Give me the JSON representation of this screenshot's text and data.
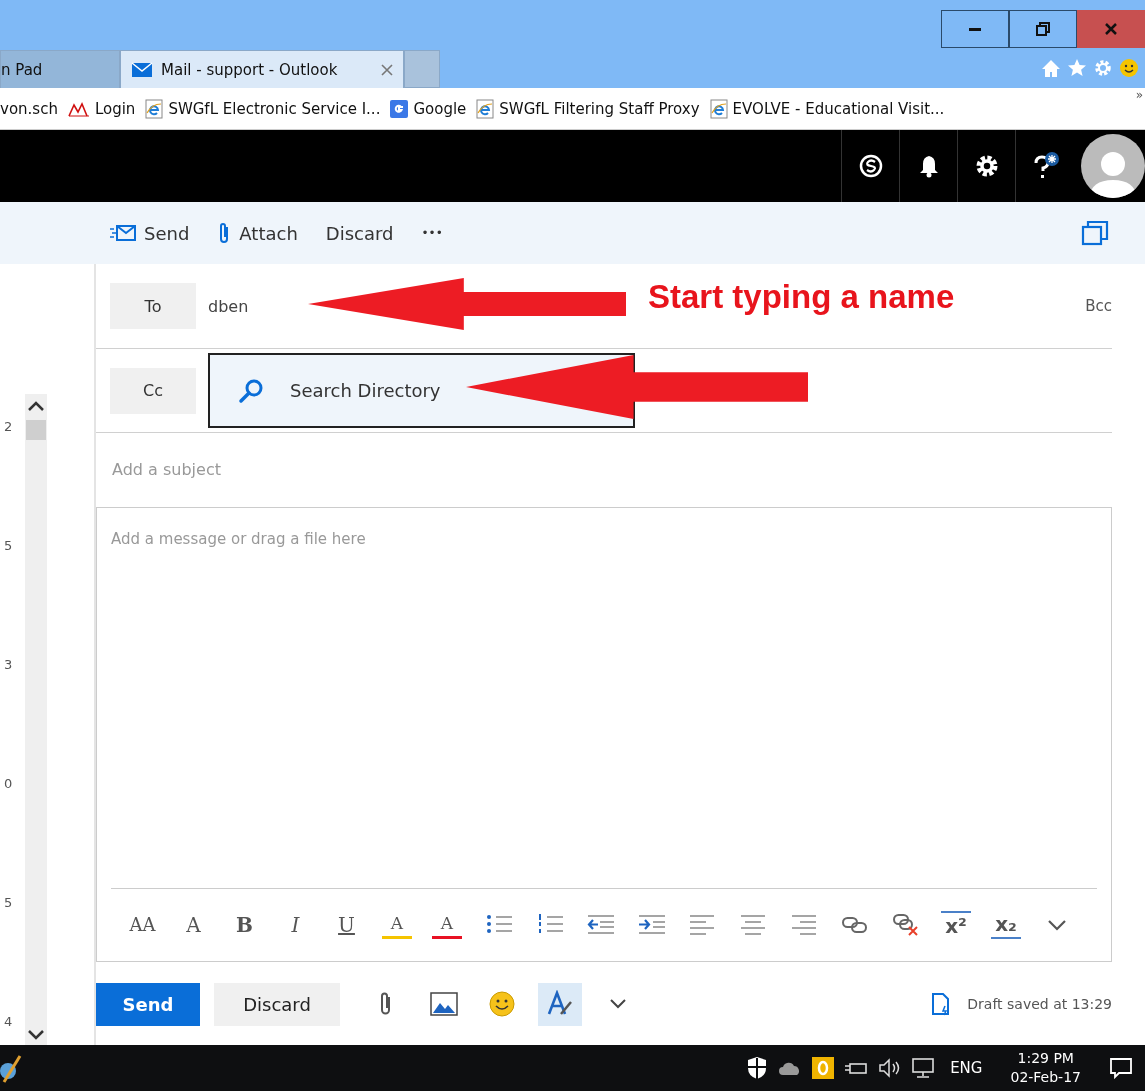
{
  "browser": {
    "tabs": [
      {
        "label": "n Pad",
        "selected": false
      },
      {
        "label": "Mail - support - Outlook",
        "selected": true
      }
    ],
    "favorites": [
      {
        "kind": "plain",
        "label": "von.sch"
      },
      {
        "kind": "chart",
        "label": "Login"
      },
      {
        "kind": "ie",
        "label": "SWGfL Electronic Service I..."
      },
      {
        "kind": "google",
        "label": "Google"
      },
      {
        "kind": "ie",
        "label": "SWGfL Filtering Staff Proxy"
      },
      {
        "kind": "ie",
        "label": "EVOLVE - Educational Visit..."
      }
    ],
    "overflow": "»"
  },
  "command_bar": [
    {
      "kind": "send",
      "label": "Send"
    },
    {
      "kind": "attach",
      "label": "Attach"
    },
    {
      "kind": "plain",
      "label": "Discard"
    },
    {
      "kind": "more",
      "label": "•••"
    }
  ],
  "side_numbers": [
    "2",
    "5",
    "3",
    "0",
    "5",
    "4"
  ],
  "compose": {
    "to": {
      "label": "To",
      "value": "dben"
    },
    "bcc": "Bcc",
    "cc": {
      "label": "Cc"
    },
    "suggestion": "Search Directory",
    "subject_placeholder": "Add a subject",
    "body_placeholder": "Add a message or drag a file here",
    "format_tools": [
      {
        "kind": "font-size",
        "glyph": "AA"
      },
      {
        "kind": "grow",
        "glyph": "A"
      },
      {
        "kind": "bold",
        "glyph": "B"
      },
      {
        "kind": "italic",
        "glyph": "I"
      },
      {
        "kind": "underline",
        "glyph": "U"
      },
      {
        "kind": "highlight",
        "glyph": "A"
      },
      {
        "kind": "font-color",
        "glyph": "A"
      },
      {
        "kind": "bullets"
      },
      {
        "kind": "numbering"
      },
      {
        "kind": "outdent"
      },
      {
        "kind": "indent"
      },
      {
        "kind": "align-left"
      },
      {
        "kind": "align-center"
      },
      {
        "kind": "align-right"
      },
      {
        "kind": "link"
      },
      {
        "kind": "unlink"
      },
      {
        "kind": "superscript",
        "glyph": "x²"
      },
      {
        "kind": "subscript",
        "glyph": "x₂"
      },
      {
        "kind": "more"
      }
    ],
    "send": "Send",
    "discard": "Discard",
    "extras": [
      {
        "kind": "attach",
        "selected": false
      },
      {
        "kind": "picture",
        "selected": false
      },
      {
        "kind": "emoji",
        "selected": false
      },
      {
        "kind": "format",
        "selected": true
      },
      {
        "kind": "chevron",
        "selected": false
      }
    ],
    "draft_status": "Draft saved at 13:29"
  },
  "annotations": [
    {
      "kind": "arrow",
      "text": "Start typing a name"
    },
    {
      "kind": "arrow"
    }
  ],
  "taskbar": {
    "language": "ENG",
    "time": "1:29 PM",
    "date": "02-Feb-17"
  }
}
